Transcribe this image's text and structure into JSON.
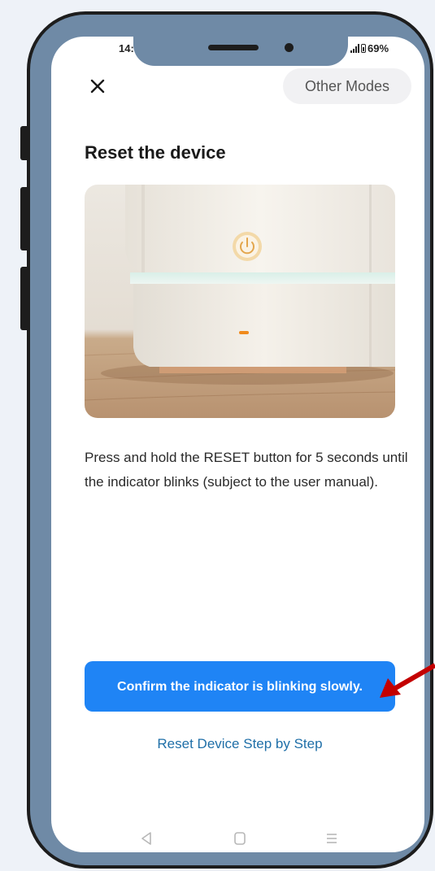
{
  "status_bar": {
    "time": "14:",
    "battery": "69%"
  },
  "header": {
    "close_icon": "close-icon",
    "other_modes_label": "Other Modes"
  },
  "main": {
    "title": "Reset the device",
    "image_subject": "device-photo",
    "description": "Press and hold the RESET button for 5 seconds until the indicator blinks (subject to the user manual).",
    "confirm_label": "Confirm the indicator is blinking slowly.",
    "step_link_label": "Reset Device Step by Step"
  },
  "nav": {
    "back_icon": "back-icon",
    "home_icon": "home-icon",
    "menu_icon": "menu-icon"
  },
  "annotation": {
    "arrow_color": "#c40000"
  },
  "colors": {
    "accent": "#1f84f5",
    "link": "#1f6fa8",
    "frame": "#6f8aa6"
  }
}
